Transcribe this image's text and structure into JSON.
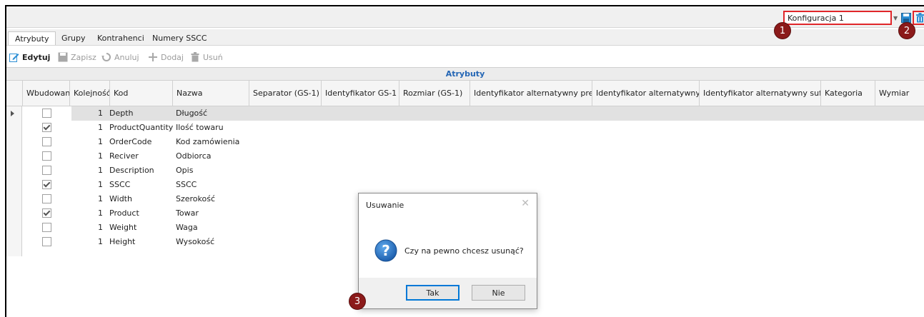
{
  "config": {
    "selected": "Konfiguracja 1"
  },
  "badges": [
    "1",
    "2",
    "3"
  ],
  "tabs": [
    {
      "label": "Atrybuty",
      "active": true
    },
    {
      "label": "Grupy",
      "active": false
    },
    {
      "label": "Kontrahenci",
      "active": false
    },
    {
      "label": "Numery SSCC",
      "active": false
    }
  ],
  "toolbar": {
    "edit": "Edytuj",
    "save": "Zapisz",
    "cancel": "Anuluj",
    "add": "Dodaj",
    "delete": "Usuń"
  },
  "grid": {
    "group_title": "Atrybuty",
    "columns": [
      "Wbudowany",
      "Kolejność",
      "Kod",
      "Nazwa",
      "Separator (GS-1)",
      "Identyfikator GS-1",
      "Rozmiar (GS-1)",
      "Identyfikator alternatywny prefix",
      "Identyfikator alternatywny",
      "Identyfikator alternatywny suffix",
      "Kategoria",
      "Wymiar"
    ],
    "rows": [
      {
        "builtin": false,
        "order": "1",
        "code": "Depth",
        "name": "Długość"
      },
      {
        "builtin": true,
        "order": "1",
        "code": "ProductQuantity",
        "name": "Ilość towaru"
      },
      {
        "builtin": false,
        "order": "1",
        "code": "OrderCode",
        "name": "Kod zamówienia"
      },
      {
        "builtin": false,
        "order": "1",
        "code": "Reciver",
        "name": "Odbiorca"
      },
      {
        "builtin": false,
        "order": "1",
        "code": "Description",
        "name": "Opis"
      },
      {
        "builtin": true,
        "order": "1",
        "code": "SSCC",
        "name": "SSCC"
      },
      {
        "builtin": false,
        "order": "1",
        "code": "Width",
        "name": "Szerokość"
      },
      {
        "builtin": true,
        "order": "1",
        "code": "Product",
        "name": "Towar"
      },
      {
        "builtin": false,
        "order": "1",
        "code": "Weight",
        "name": "Waga"
      },
      {
        "builtin": false,
        "order": "1",
        "code": "Height",
        "name": "Wysokość"
      }
    ]
  },
  "dialog": {
    "title": "Usuwanie",
    "message": "Czy na pewno chcesz usunąć?",
    "yes": "Tak",
    "no": "Nie",
    "icon": "question-icon"
  },
  "colors": {
    "highlight_border": "#e0262a",
    "badge": "#8b1a1a",
    "group_title": "#2466b5",
    "primary_button_border": "#0078d7"
  }
}
